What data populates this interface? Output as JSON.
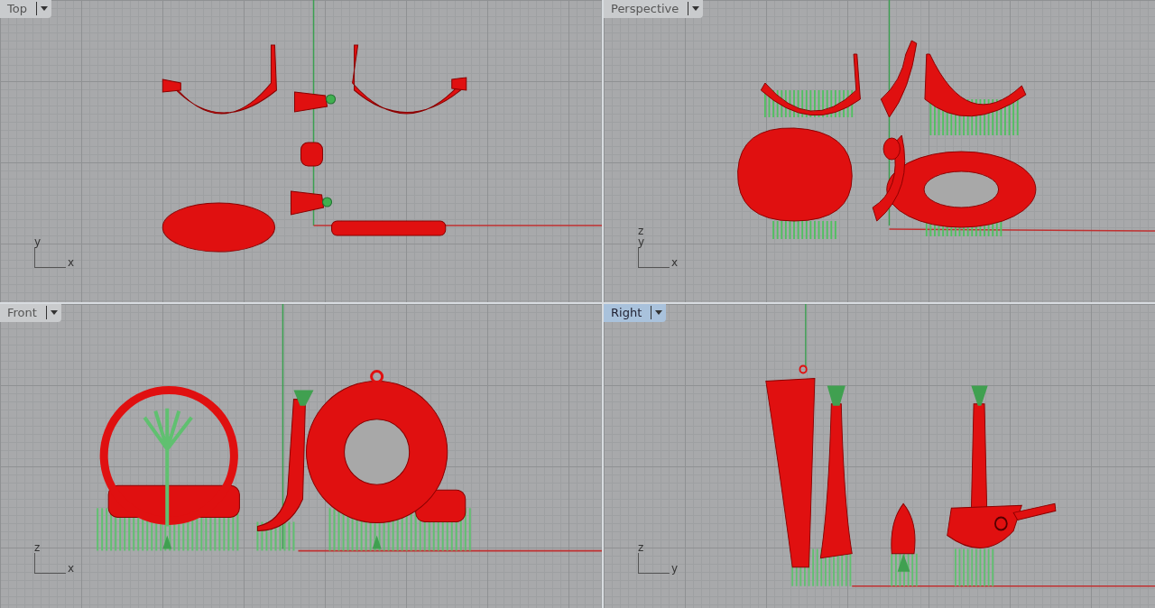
{
  "viewports": [
    {
      "title": "Top",
      "selected": false,
      "axis": {
        "vertical": [
          "y"
        ],
        "horizontal": "x"
      }
    },
    {
      "title": "Perspective",
      "selected": false,
      "axis": {
        "vertical": [
          "z",
          "y"
        ],
        "horizontal": "x"
      }
    },
    {
      "title": "Front",
      "selected": false,
      "axis": {
        "vertical": [
          "z"
        ],
        "horizontal": "x"
      }
    },
    {
      "title": "Right",
      "selected": true,
      "axis": {
        "vertical": [
          "z"
        ],
        "horizontal": "y"
      }
    }
  ]
}
